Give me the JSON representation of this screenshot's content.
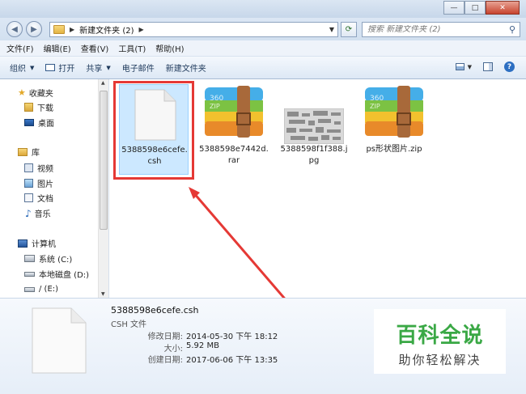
{
  "breadcrumb": {
    "folder": "新建文件夹 (2)"
  },
  "search": {
    "placeholder": "搜索 新建文件夹 (2)"
  },
  "menu": [
    "文件(F)",
    "编辑(E)",
    "查看(V)",
    "工具(T)",
    "帮助(H)"
  ],
  "toolbar": {
    "organize": "组织",
    "open": "打开",
    "share": "共享",
    "email": "电子邮件",
    "new_folder": "新建文件夹"
  },
  "nav": {
    "favorites": "收藏夹",
    "downloads": "下载",
    "desktop": "桌面",
    "libraries": "库",
    "videos": "视频",
    "pictures": "图片",
    "documents": "文档",
    "music": "音乐",
    "computer": "计算机",
    "drive_c": "系统 (C:)",
    "drive_d": "本地磁盘 (D:)",
    "drive_e": "/ (E:)"
  },
  "files": [
    {
      "name": "5388598e6cefe.csh",
      "icon": "blank-document-icon",
      "selected": true
    },
    {
      "name": "5388598e7442d.rar",
      "icon": "360zip-archive-icon"
    },
    {
      "name": "5388598f1f388.jpg",
      "icon": "image-thumbnail-icon"
    },
    {
      "name": "ps形状图片.zip",
      "icon": "360zip-archive-icon"
    }
  ],
  "details": {
    "filename": "5388598e6cefe.csh",
    "type": "CSH 文件",
    "modified_label": "修改日期:",
    "modified": "2014-05-30 下午 18:12",
    "size_label": "大小:",
    "size": "5.92 MB",
    "created_label": "创建日期:",
    "created": "2017-06-06 下午 13:35"
  },
  "watermark": {
    "title": "百科全说",
    "subtitle": "助你轻松解决"
  },
  "colors": {
    "annotation": "#e53935",
    "selection": "#cce8ff",
    "watermark": "#3aa845"
  }
}
